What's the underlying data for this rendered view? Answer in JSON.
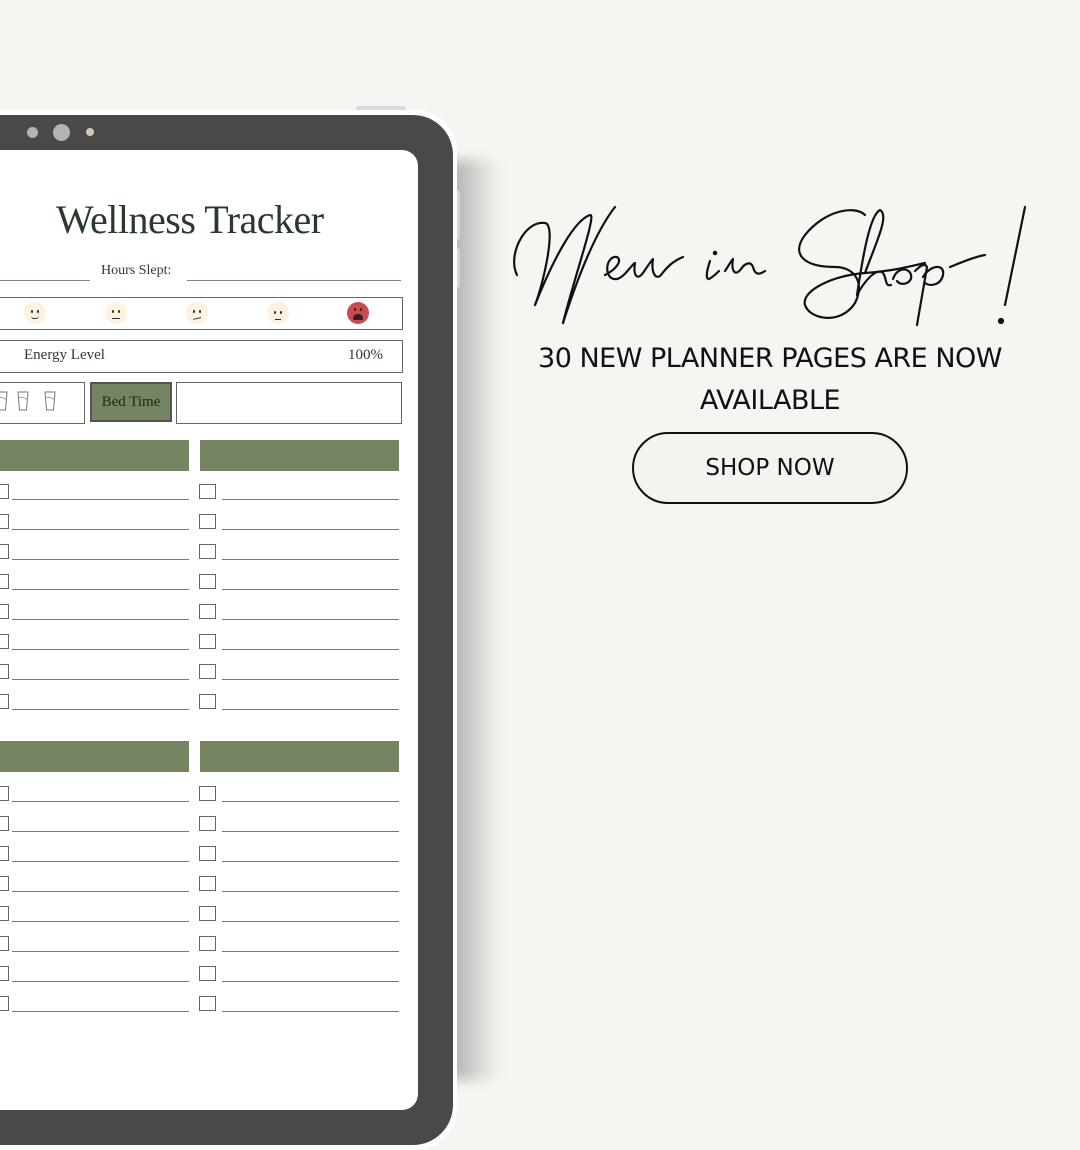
{
  "tablet": {
    "page_title": "Wellness Tracker",
    "hours_slept_label": "Hours Slept:",
    "mood_icons": [
      "happy-face-icon",
      "neutral-face-icon",
      "confused-face-icon",
      "tired-face-icon",
      "weary-face-icon"
    ],
    "energy": {
      "label": "Energy Level",
      "value": "100%"
    },
    "water_glasses_visible": 3,
    "bed_time_label": "Bed Time",
    "accent_color": "#758562",
    "sections": [
      {
        "rows": 8,
        "columns": 2
      },
      {
        "rows": 8,
        "columns": 2
      }
    ]
  },
  "promo": {
    "headline": "New in Shop!",
    "subtitle_line1": "30 NEW PLANNER PAGES ARE NOW",
    "subtitle_line2": "AVAILABLE",
    "cta_label": "SHOP NOW"
  }
}
